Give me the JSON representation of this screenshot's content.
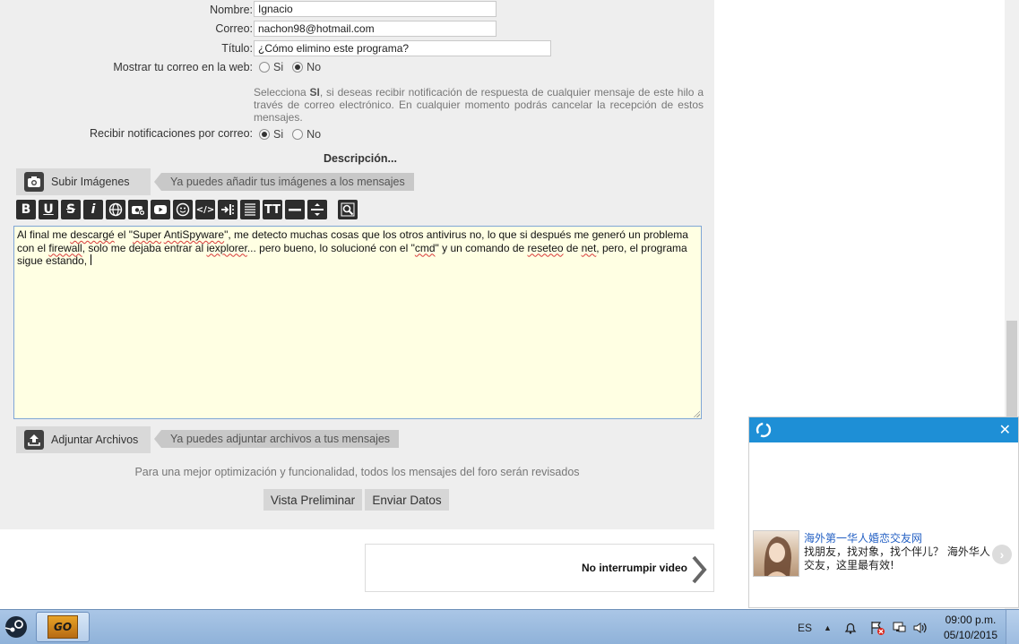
{
  "form": {
    "name_label": "Nombre:",
    "name_value": "Ignacio",
    "email_label": "Correo:",
    "email_value": "nachon98@hotmail.com",
    "title_label": "Título:",
    "title_value": "¿Cómo elimino este programa?",
    "show_email_label": "Mostrar tu correo en la web:",
    "show_email_options": [
      "Si",
      "No"
    ],
    "show_email_selected": "No",
    "notice_strong": "SI",
    "notice_pre": "Selecciona ",
    "notice_post": ", si deseas recibir notificación de respuesta de cualquier mensaje de este hilo a través de correo electrónico. En cualquier momento podrás cancelar la recepción de estos mensajes.",
    "notify_label": "Recibir notificaciones por correo:",
    "notify_options": [
      "Si",
      "No"
    ],
    "notify_selected": "Si",
    "description_label": "Descripción..."
  },
  "upload_images": {
    "button_label": "Subir Imágenes",
    "hint": "Ya puedes añadir tus imágenes a los mensajes"
  },
  "toolbar": {
    "buttons": [
      "bold",
      "underline",
      "strikethrough",
      "italic",
      "link",
      "image",
      "youtube",
      "emoticon",
      "code",
      "indent",
      "justify",
      "text-size",
      "horizontal-rule",
      "spacing",
      "preview"
    ]
  },
  "editor": {
    "text_parts": [
      {
        "t": "Al final me ",
        "s": false
      },
      {
        "t": "descargé",
        "s": true
      },
      {
        "t": " el \"",
        "s": false
      },
      {
        "t": "Super",
        "s": true
      },
      {
        "t": " ",
        "s": false
      },
      {
        "t": "AntiSpyware",
        "s": true
      },
      {
        "t": "\", me detecto muchas cosas que los otros antivirus no, lo que si después me generó un problema con el ",
        "s": false
      },
      {
        "t": "firewall",
        "s": true
      },
      {
        "t": ", solo me dejaba entrar al ",
        "s": false
      },
      {
        "t": "iexplorer",
        "s": true
      },
      {
        "t": "... pero bueno, lo solucioné con el \"",
        "s": false
      },
      {
        "t": "cmd",
        "s": true
      },
      {
        "t": "\" y un comando de ",
        "s": false
      },
      {
        "t": "reseteo",
        "s": true
      },
      {
        "t": " de ",
        "s": false
      },
      {
        "t": "net",
        "s": true
      },
      {
        "t": ", pero, el programa sigue estando, ",
        "s": false
      }
    ]
  },
  "attach_files": {
    "button_label": "Adjuntar Archivos",
    "hint": "Ya puedes adjuntar archivos a tus mensajes"
  },
  "footer_note": "Para una mejor optimización y funcionalidad, todos los mensajes del foro serán revisados",
  "actions": {
    "preview": "Vista Preliminar",
    "submit": "Enviar Datos"
  },
  "next_box": {
    "label": "No interrumpir video"
  },
  "popup": {
    "ad_title": "海外第一华人婚恋交友网",
    "ad_text": "找朋友，找对象，找个伴儿？ 海外华人交友，这里最有效!",
    "accent": "#1e8fd6"
  },
  "taskbar": {
    "apps": [
      "steam-icon",
      "csgo-icon"
    ],
    "csgo_label": "GO",
    "language": "ES",
    "time": "09:00 p.m.",
    "date": "05/10/2015"
  }
}
